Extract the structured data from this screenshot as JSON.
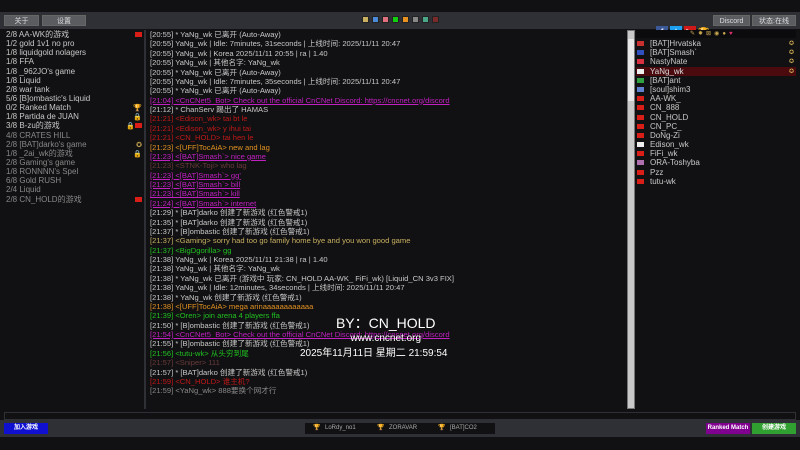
{
  "toolbar": {
    "about": "关于",
    "settings": "设置",
    "swatches": [
      "#c8b060",
      "#4a8ad8",
      "#e0707e",
      "#10d010",
      "#e89020",
      "#888888",
      "#4aa888",
      "#7a2a2a"
    ],
    "social": [
      "facebook-icon",
      "twitter-icon",
      "youtube-icon",
      "trophy-icon"
    ],
    "discord": "Discord",
    "status": "状态:在线"
  },
  "games": [
    {
      "text": "2/8  AA-WK的游戏",
      "icon": "flag",
      "dim": false
    },
    {
      "text": "1/2  gold 1v1 no pro",
      "icon": "",
      "dim": false
    },
    {
      "text": "1/8  liquidgold nolagers",
      "icon": "",
      "dim": false
    },
    {
      "text": "1/8  FFA",
      "icon": "",
      "dim": false
    },
    {
      "text": "1/8  _962JO's game",
      "icon": "",
      "dim": false
    },
    {
      "text": "1/8  Liquid",
      "icon": "",
      "dim": false
    },
    {
      "text": "2/8  war tank",
      "icon": "",
      "dim": false
    },
    {
      "text": "5/6  [B]ombastic's Liquid",
      "icon": "",
      "dim": false
    },
    {
      "text": "0/2  Ranked Match",
      "icon": "trophy",
      "dim": false
    },
    {
      "text": "1/8  Partida de JUAN",
      "icon": "lock",
      "dim": false
    },
    {
      "text": "3/8  B-zu的游戏",
      "icon": "lockflag",
      "dim": false
    },
    {
      "text": "4/8  CRATES HILL",
      "icon": "",
      "dim": true
    },
    {
      "text": "2/8  [BAT]darko's game",
      "icon": "medal",
      "dim": true
    },
    {
      "text": "1/8  _2ai_wk的游戏",
      "icon": "lock",
      "dim": true
    },
    {
      "text": "2/8  Gaming's game",
      "icon": "",
      "dim": true
    },
    {
      "text": "1/8  RONNNN's Spel",
      "icon": "",
      "dim": true
    },
    {
      "text": "6/8  Gold RUSH",
      "icon": "",
      "dim": true
    },
    {
      "text": "2/4  Liquid",
      "icon": "",
      "dim": true
    },
    {
      "text": "2/8  CN_HOLD的游戏",
      "icon": "flag",
      "dim": true
    }
  ],
  "chat": [
    {
      "t": "[20:55] * YaNg_wk 已离开 (Auto-Away)",
      "c": "#c8c8c8"
    },
    {
      "t": "[20:55] YaNg_wk | Idle: 7minutes, 31seconds | 上线时间: 2025/11/11 20:47",
      "c": "#c8c8c8"
    },
    {
      "t": "[20:55] YaNg_wk | Korea 2025/11/11 20:55 | ra | 1.40",
      "c": "#c8c8c8"
    },
    {
      "t": "[20:55] YaNg_wk | 其他名字: YaNg_wk",
      "c": "#c8c8c8"
    },
    {
      "t": "[20:55] * YaNg_wk 已离开 (Auto-Away)",
      "c": "#c8c8c8"
    },
    {
      "t": "[20:55] YaNg_wk | Idle: 7minutes, 35seconds | 上线时间: 2025/11/11 20:47",
      "c": "#c8c8c8"
    },
    {
      "t": "[20:55] * YaNg_wk 已离开 (Auto-Away)",
      "c": "#c8c8c8"
    },
    {
      "t": "[21:04] <CnCNet5_Bot> Check out the official CnCNet Discord: https://cncnet.org/discord",
      "c": "#c020c0",
      "u": true
    },
    {
      "t": "[21:12] * ChanServ 踢出了 HAMAS",
      "c": "#c8c8c8"
    },
    {
      "t": "[21:21] <Edison_wk> tai bt le",
      "c": "#c01818"
    },
    {
      "t": "[21:21] <Edison_wk> y ihui tai",
      "c": "#c01818"
    },
    {
      "t": "[21:21] <CN_HOLD> tai hen le",
      "c": "#c01818"
    },
    {
      "t": "[21:23] <[UFF]TocAiA> new and lag",
      "c": "#e09020"
    },
    {
      "t": "[21:23] <[BAT]Smash`> nice game",
      "c": "#c020c0",
      "u": true
    },
    {
      "t": "[21:23] <STNK-Toji> who lag",
      "c": "#6a3a3a"
    },
    {
      "t": "[21:23] <[BAT]Smash`> gg'",
      "c": "#c020c0",
      "u": true
    },
    {
      "t": "[21:23] <[BAT]Smash`> bill",
      "c": "#c020c0",
      "u": true
    },
    {
      "t": "[21:23] <[BAT]Smash`> kill",
      "c": "#c020c0",
      "u": true
    },
    {
      "t": "[21:24] <[BAT]Smash`> internet",
      "c": "#c020c0",
      "u": true
    },
    {
      "t": "[21:29] * [BAT]darko 创建了新游戏 (红色警戒1)",
      "c": "#c8c8c8"
    },
    {
      "t": "[21:35] * [BAT]darko 创建了新游戏 (红色警戒1)",
      "c": "#c8c8c8"
    },
    {
      "t": "[21:37] * [B]ombastic 创建了新游戏 (红色警戒1)",
      "c": "#c8c8c8"
    },
    {
      "t": "[21:37] <Gaming> sorry had too go family home bye and you won good game",
      "c": "#c8b060"
    },
    {
      "t": "[21:37] <BigDgorilla> gg",
      "c": "#20c020"
    },
    {
      "t": "[21:38] YaNg_wk | Korea 2025/11/11 21:38 | ra | 1.40",
      "c": "#c8c8c8"
    },
    {
      "t": "[21:38] YaNg_wk | 其他名字: YaNg_wk",
      "c": "#c8c8c8"
    },
    {
      "t": "[21:38] * YaNg_wk 已离开 (游戏中 玩家: CN_HOLD AA-WK_ FiFi_wk) [Liquid_CN 3v3 FIX]",
      "c": "#c8c8c8"
    },
    {
      "t": "[21:38] YaNg_wk | Idle: 12minutes, 34seconds | 上线时间: 2025/11/11 20:47",
      "c": "#c8c8c8"
    },
    {
      "t": "[21:38] * YaNg_wk 创建了新游戏 (红色警戒1)",
      "c": "#c8c8c8"
    },
    {
      "t": "[21:38] <[UFF]TocAiA> mega arinaaaaaaaaaaaa",
      "c": "#e09020"
    },
    {
      "t": "[21:39] <Oren> join arena 4 players ffa",
      "c": "#20c020"
    },
    {
      "t": "[21:50] * [B]ombastic 创建了新游戏 (红色警戒1)",
      "c": "#c8c8c8"
    },
    {
      "t": "[21:54] <CnCNet5_Bot> Check out the official CnCNet Discord: https://cncnet.org/discord",
      "c": "#c020c0",
      "u": true
    },
    {
      "t": "[21:55] * [B]ombastic 创建了新游戏 (红色警戒1)",
      "c": "#c8c8c8"
    },
    {
      "t": "[21:56]  <tutu-wk> 从头穷到尾",
      "c": "#20c020"
    },
    {
      "t": "[21:57] <Sniper> 111",
      "c": "#6a3a3a"
    },
    {
      "t": "[21:57] * [BAT]darko 创建了新游戏 (红色警戒1)",
      "c": "#c8c8c8"
    },
    {
      "t": "[21:59]  <CN_HOLD> 谁主机?",
      "c": "#c01818"
    },
    {
      "t": "[21:59] <YaNg_wk> 888要换个网才行",
      "c": "#888888"
    }
  ],
  "watermark": {
    "by": "BY：CN_HOLD",
    "site": "www.cncnet.org",
    "datetime": "2025年11月11日 星期二 21:59:54"
  },
  "user_icons": [
    "map-icon",
    "explosion-icon",
    "tank-icon",
    "coin-icon",
    "chat-icon",
    "heart-icon"
  ],
  "users": [
    {
      "name": "[BAT]Hrvatska",
      "flag": "#c83030",
      "badge": true
    },
    {
      "name": "[BAT]Smash`",
      "flag": "#3050c0",
      "badge": true
    },
    {
      "name": "NastyNate",
      "flag": "#d83040",
      "badge": true
    },
    {
      "name": "YaNg_wk",
      "flag": "#eeeeee",
      "badge": true,
      "selected": true
    },
    {
      "name": "[BAT]ant",
      "flag": "#30a040",
      "badge": false
    },
    {
      "name": "[soul]shim3",
      "flag": "#6080d0",
      "badge": false
    },
    {
      "name": "AA-WK_",
      "flag": "#d91e18",
      "badge": false
    },
    {
      "name": "CN_888",
      "flag": "#d91e18",
      "badge": false
    },
    {
      "name": "CN_HOLD",
      "flag": "#d91e18",
      "badge": false
    },
    {
      "name": "CN_PC_",
      "flag": "#d91e18",
      "badge": false
    },
    {
      "name": "DoNg-Zi",
      "flag": "#d91e18",
      "badge": false
    },
    {
      "name": "Edison_wk",
      "flag": "#eeeeee",
      "badge": false
    },
    {
      "name": "FiFi_wk",
      "flag": "#d91e18",
      "badge": false
    },
    {
      "name": "ORA-Toshyba",
      "flag": "#b070b0",
      "badge": false
    },
    {
      "name": "Pzz",
      "flag": "#d91e18",
      "badge": false
    },
    {
      "name": "tutu-wk",
      "flag": "#d91e18",
      "badge": false
    }
  ],
  "bottom": {
    "join": "加入游戏",
    "players": [
      "LoRdy_no1",
      "ZORAVAR",
      "[BAT]CO2"
    ],
    "ranked": "Ranked Match",
    "create": "创建游戏"
  }
}
